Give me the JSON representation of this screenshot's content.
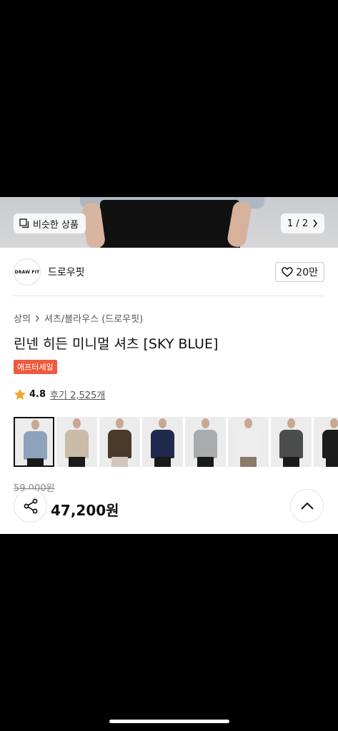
{
  "hero": {
    "similar_label": "비슷한 상품",
    "pager": "1 / 2"
  },
  "brand": {
    "logo_text": "DRAW FIT",
    "name": "드로우핏",
    "likes": "20만"
  },
  "breadcrumb": {
    "level1": "상의",
    "level2": "셔츠/블라우스 (드로우핏)"
  },
  "product": {
    "title": "린넨 히든 미니멀 셔츠 [SKY BLUE]",
    "badge": "애프터세일",
    "rating": "4.8",
    "reviews": "후기 2,525개",
    "price_original": "59,000원",
    "price_current": "47,200원"
  },
  "thumbnails": [
    {
      "name": "sky-blue",
      "color": "#8fa2bb",
      "pants": "#1a1a1a"
    },
    {
      "name": "beige",
      "color": "#cbbcaa",
      "pants": "#1a1a1a"
    },
    {
      "name": "brown",
      "color": "#4a3a2a",
      "pants": "#cfc7bb"
    },
    {
      "name": "navy",
      "color": "#1f2a4d",
      "pants": "#1a1a1a"
    },
    {
      "name": "light-gray",
      "color": "#a9abad",
      "pants": "#1a1a1a"
    },
    {
      "name": "white",
      "color": "#eeeeee",
      "pants": "#8a7a6a"
    },
    {
      "name": "charcoal",
      "color": "#4a4d4b",
      "pants": "#1a1a1a"
    },
    {
      "name": "black",
      "color": "#1c1c1c",
      "pants": "#1a1a1a"
    }
  ],
  "colors": {
    "badge": "#f05a3c",
    "star": "#f5a623"
  }
}
